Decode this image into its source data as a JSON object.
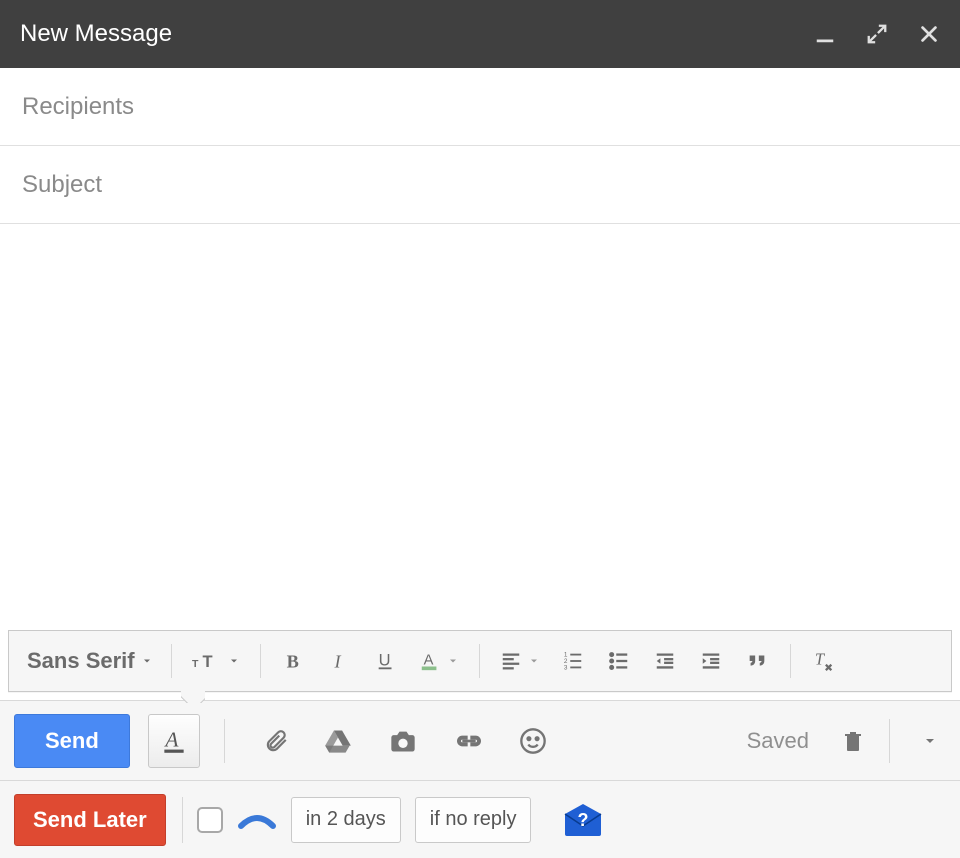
{
  "header": {
    "title": "New Message"
  },
  "fields": {
    "recipients_placeholder": "Recipients",
    "recipients_value": "",
    "subject_placeholder": "Subject",
    "subject_value": ""
  },
  "body_value": "",
  "formatting": {
    "font_label": "Sans Serif"
  },
  "actionbar": {
    "send_label": "Send",
    "saved_label": "Saved"
  },
  "sendlater": {
    "button_label": "Send Later",
    "time_label": "in 2 days",
    "condition_label": "if no reply"
  }
}
